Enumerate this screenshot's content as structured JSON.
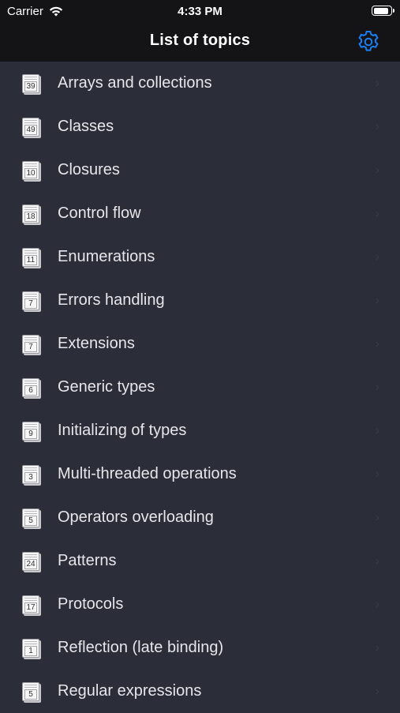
{
  "status_bar": {
    "carrier": "Carrier",
    "time": "4:33 PM",
    "battery_level": 0.9
  },
  "nav": {
    "title": "List of topics",
    "settings_icon": "gear-icon"
  },
  "colors": {
    "accent": "#1a7ef2",
    "background": "#2b2d38",
    "bar": "#141416"
  },
  "topics": [
    {
      "count": "39",
      "label": "Arrays and collections"
    },
    {
      "count": "49",
      "label": "Classes"
    },
    {
      "count": "10",
      "label": "Closures"
    },
    {
      "count": "18",
      "label": "Control flow"
    },
    {
      "count": "11",
      "label": "Enumerations"
    },
    {
      "count": "7",
      "label": "Errors handling"
    },
    {
      "count": "7",
      "label": "Extensions"
    },
    {
      "count": "6",
      "label": "Generic types"
    },
    {
      "count": "9",
      "label": "Initializing of types"
    },
    {
      "count": "3",
      "label": "Multi-threaded operations"
    },
    {
      "count": "5",
      "label": "Operators overloading"
    },
    {
      "count": "24",
      "label": "Patterns"
    },
    {
      "count": "17",
      "label": "Protocols"
    },
    {
      "count": "1",
      "label": "Reflection (late binding)"
    },
    {
      "count": "5",
      "label": "Regular expressions"
    }
  ]
}
